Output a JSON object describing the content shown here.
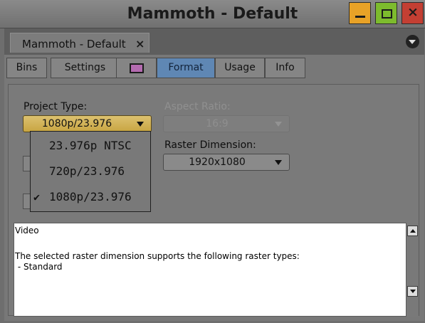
{
  "window": {
    "title": "Mammoth - Default"
  },
  "tab": {
    "label": "Mammoth - Default",
    "close": "×"
  },
  "subtabs": [
    "Bins",
    "Settings",
    "",
    "Format",
    "Usage",
    "Info"
  ],
  "format": {
    "project_type_label": "Project Type:",
    "project_type_value": "1080p/23.976",
    "aspect_ratio_label": "Aspect Ratio:",
    "aspect_ratio_value": "16:9",
    "raster_label": "Raster Dimension:",
    "raster_value": "1920x1080",
    "options": [
      "23.976p NTSC",
      "720p/23.976",
      "1080p/23.976"
    ],
    "selected_index": 2,
    "check": "✔"
  },
  "description": {
    "title": "Video",
    "body": "The selected raster dimension supports the following raster types:\n - Standard"
  },
  "colors": {
    "active_tab": "#5f87b4",
    "project_dropdown": "#d4b65c",
    "bin_icon": "#b46bb0"
  },
  "icons": [
    "minimize-icon",
    "maximize-icon",
    "close-icon",
    "panel-menu-icon",
    "bin-color-icon",
    "chevron-down-icon",
    "checkmark-icon",
    "scroll-up-icon",
    "scroll-down-icon"
  ]
}
